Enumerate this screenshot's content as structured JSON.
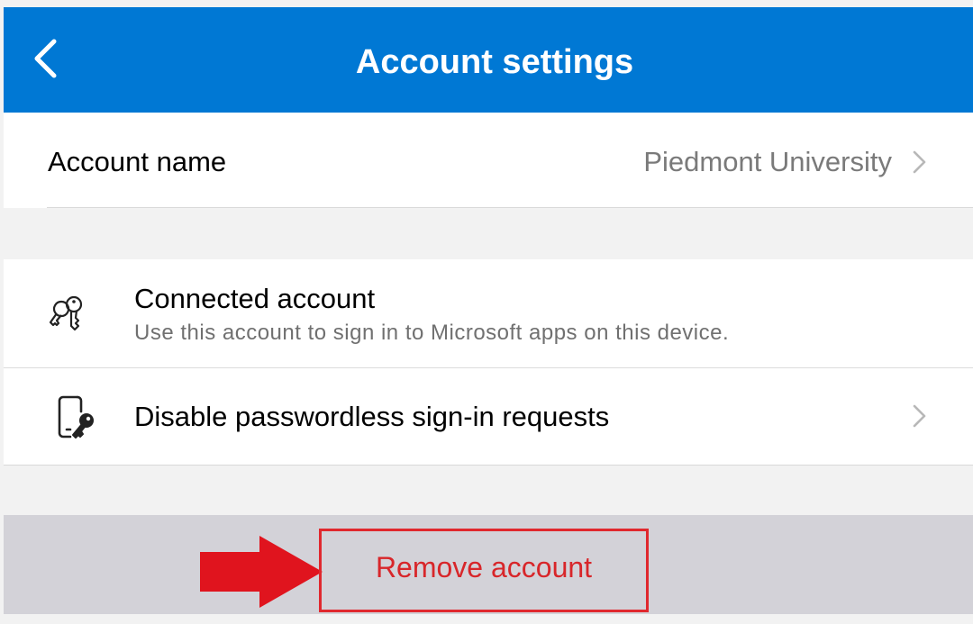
{
  "header": {
    "title": "Account settings",
    "back_icon": "chevron-left-icon",
    "background": "#0078d4"
  },
  "account_name_row": {
    "label": "Account name",
    "value": "Piedmont University",
    "chevron_icon": "chevron-right-icon"
  },
  "items": [
    {
      "icon": "keys-icon",
      "title": "Connected account",
      "subtitle": "Use this account to sign in to Microsoft apps on this device."
    },
    {
      "icon": "phone-key-icon",
      "title": "Disable passwordless sign-in requests",
      "chevron_icon": "chevron-right-icon"
    }
  ],
  "remove": {
    "label": "Remove account",
    "color": "#d8262a",
    "annotation_arrow_icon": "arrow-right-icon"
  }
}
